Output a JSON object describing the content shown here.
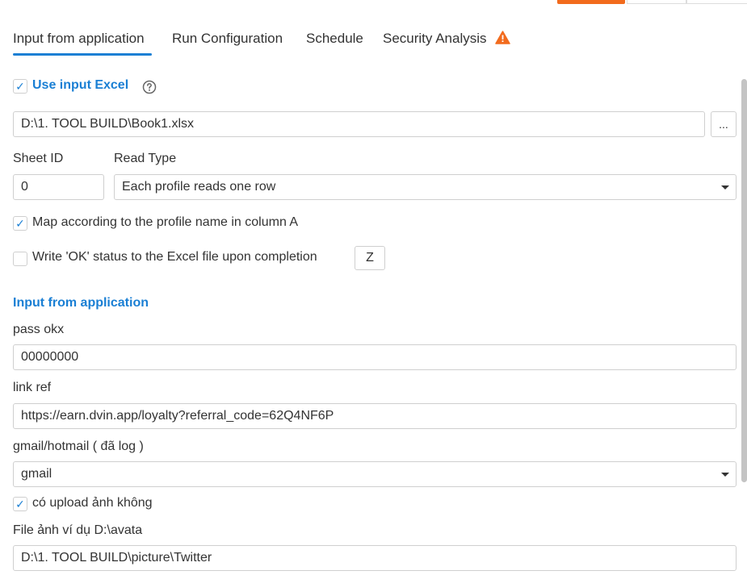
{
  "tabs": [
    {
      "label": "Input from application"
    },
    {
      "label": "Run Configuration"
    },
    {
      "label": "Schedule"
    },
    {
      "label": "Security Analysis"
    }
  ],
  "use_excel": {
    "label": "Use input Excel",
    "checked": true
  },
  "excel_path": {
    "value": "D:\\1. TOOL BUILD\\Book1.xlsx"
  },
  "browse_button": {
    "label": "..."
  },
  "sheet_id": {
    "label": "Sheet ID",
    "value": "0"
  },
  "read_type": {
    "label": "Read Type",
    "value": "Each profile reads one row"
  },
  "map_profile": {
    "label": "Map according to the profile name in column A",
    "checked": true
  },
  "write_ok": {
    "label": "Write 'OK' status to the Excel file upon completion",
    "checked": false,
    "column": "Z"
  },
  "input_section": {
    "title": "Input from application"
  },
  "fields": {
    "pass_okx": {
      "label": "pass okx",
      "value": "00000000"
    },
    "link_ref": {
      "label": "link ref",
      "value": "https://earn.dvin.app/loyalty?referral_code=62Q4NF6P"
    },
    "gmail": {
      "label": "gmail/hotmail ( đã log )",
      "value": "gmail"
    },
    "upload": {
      "label": "có upload ảnh không",
      "checked": true
    },
    "file_avatar": {
      "label": "File ảnh ví dụ D:\\avata",
      "value": "D:\\1. TOOL BUILD\\picture\\Twitter"
    }
  },
  "colors": {
    "accent": "#1a7fd4",
    "warning": "#f26b1d"
  },
  "icons": {
    "check": "✓",
    "help": "help-circle-icon",
    "warning": "warning-triangle-icon"
  }
}
